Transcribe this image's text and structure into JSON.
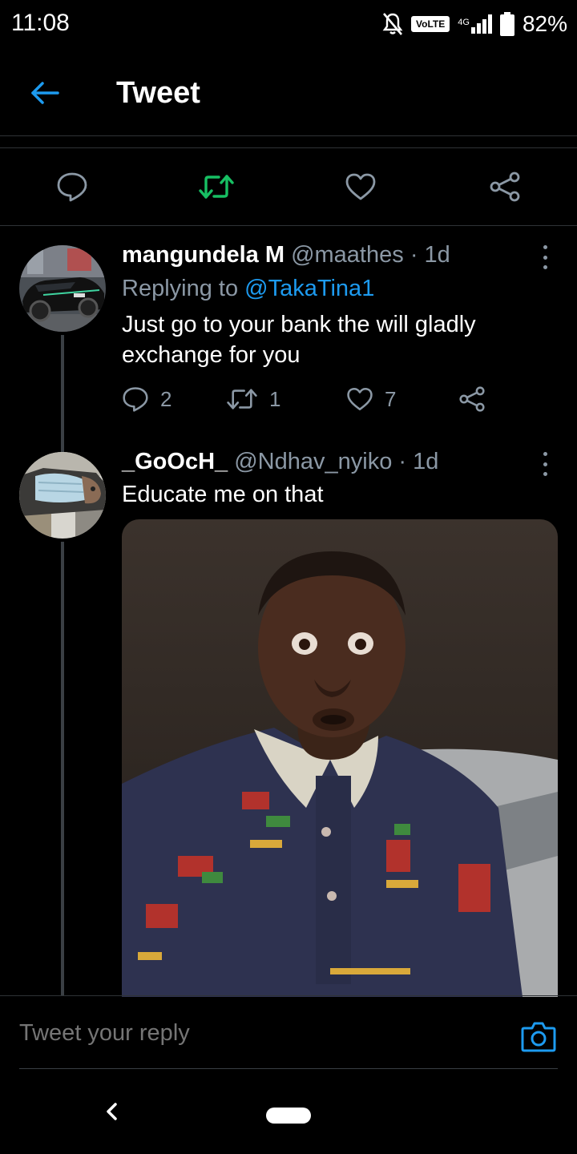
{
  "status_bar": {
    "time": "11:08",
    "volte": "VoLTE",
    "network": "4G",
    "battery": "82%"
  },
  "header": {
    "title": "Tweet",
    "back_icon": "arrow-left-icon"
  },
  "action_bar": {
    "icons": [
      "reply-icon",
      "retweet-icon",
      "like-icon",
      "share-icon"
    ],
    "retweet_color": "#17bf63"
  },
  "tweets": [
    {
      "name": "mangundela M",
      "handle": "@maathes",
      "separator": "·",
      "time": "1d",
      "replying_label": "Replying to ",
      "replying_to": "@TakaTina1",
      "text": "Just go to your bank the will gladly exchange for you",
      "replies": "2",
      "retweets": "1",
      "likes": "7"
    },
    {
      "name": "_GoOcH_",
      "handle": "@Ndhav_nyiko",
      "separator": "·",
      "time": "1d",
      "text": "Educate me on that"
    }
  ],
  "reply_bar": {
    "placeholder": "Tweet your reply",
    "camera_icon": "camera-icon"
  },
  "colors": {
    "accent": "#1d9bf0",
    "muted": "#8b98a5",
    "divider": "#2f3336"
  }
}
